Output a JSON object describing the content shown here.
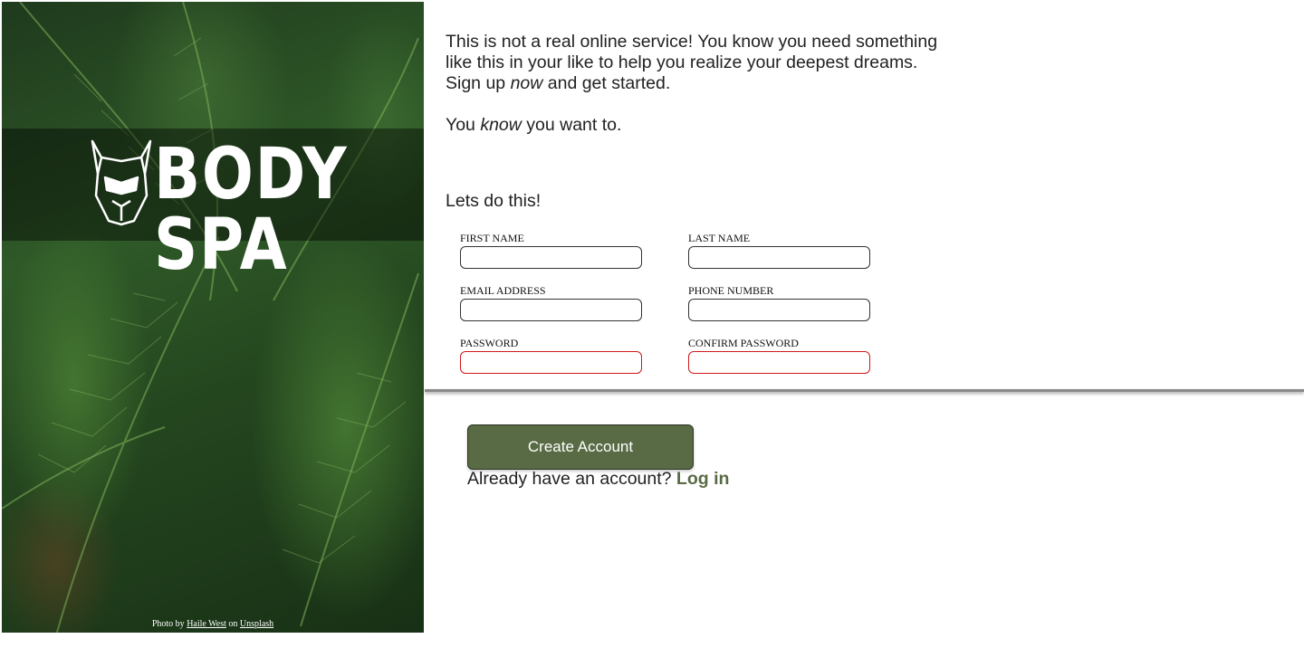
{
  "brand": {
    "logo_text": "BODY SPA",
    "logo_icon": "viking-dog-icon"
  },
  "photo_credit": {
    "prefix": "Photo by",
    "author": "Haile West",
    "middle": "on",
    "site": "Unsplash"
  },
  "intro": {
    "line1": "This is not a real online service! You know you need something",
    "line2": "like this in your like to help you realize your deepest dreams.",
    "line3_a": "Sign up ",
    "line3_em": "now",
    "line3_b": " and get started.",
    "p2_a": "You ",
    "p2_em": "know",
    "p2_b": " you want to."
  },
  "form": {
    "heading": "Lets do this!",
    "fields": {
      "first_name": {
        "label": "FIRST NAME",
        "value": ""
      },
      "last_name": {
        "label": "LAST NAME",
        "value": ""
      },
      "email": {
        "label": "EMAIL ADDRESS",
        "value": ""
      },
      "phone": {
        "label": "PHONE NUMBER",
        "value": ""
      },
      "password": {
        "label": "PASSWORD",
        "value": ""
      },
      "confirm_password": {
        "label": "CONFIRM PASSWORD",
        "value": ""
      }
    }
  },
  "actions": {
    "create_label": "Create Account",
    "login_prompt": "Already have an account?",
    "login_link": "Log in"
  },
  "colors": {
    "accent": "#596b45",
    "invalid_border": "#d01818"
  }
}
